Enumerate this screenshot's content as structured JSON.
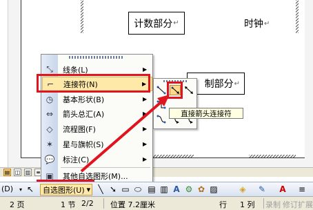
{
  "document": {
    "boxes": {
      "counting": "计数部分",
      "clock": "时钟",
      "control": "制部分"
    },
    "paragraph_mark": "↵"
  },
  "menu": {
    "items": [
      {
        "label": "线条(L)",
        "icon": "lines-icon",
        "has_submenu": true
      },
      {
        "label": "连接符(N)",
        "icon": "connector-icon",
        "has_submenu": true
      },
      {
        "label": "基本形状(B)",
        "icon": "basic-shapes-icon",
        "has_submenu": true
      },
      {
        "label": "箭头总汇(A)",
        "icon": "block-arrows-icon",
        "has_submenu": true
      },
      {
        "label": "流程图(F)",
        "icon": "flowchart-icon",
        "has_submenu": true
      },
      {
        "label": "星与旗帜(S)",
        "icon": "stars-banners-icon",
        "has_submenu": true
      },
      {
        "label": "标注(C)",
        "icon": "callouts-icon",
        "has_submenu": true
      },
      {
        "label": "其他自选图形(M)...",
        "icon": "more-autoshapes-icon",
        "has_submenu": false
      }
    ],
    "highlighted_index": 1
  },
  "submenu": {
    "tooltip": "直接箭头连接符",
    "selected_tool": "straight-arrow-connector"
  },
  "toolbar": {
    "draw_label": "(D)",
    "autoshape_label": "自选图形(U)",
    "dropdown_arrow": "▾"
  },
  "status": {
    "page": "2 页",
    "section": "1 节",
    "page_of": "2/2",
    "position": "位置 7.2厘米",
    "line": "行",
    "column": "1 列",
    "record": "录制",
    "revise": "修订",
    "extend": "扩展"
  },
  "colors": {
    "highlight_fill": "#ffe9a8",
    "highlight_border": "#e2b24a",
    "annotation_red": "#e0141e",
    "tooltip_bg": "#ffffe1"
  }
}
